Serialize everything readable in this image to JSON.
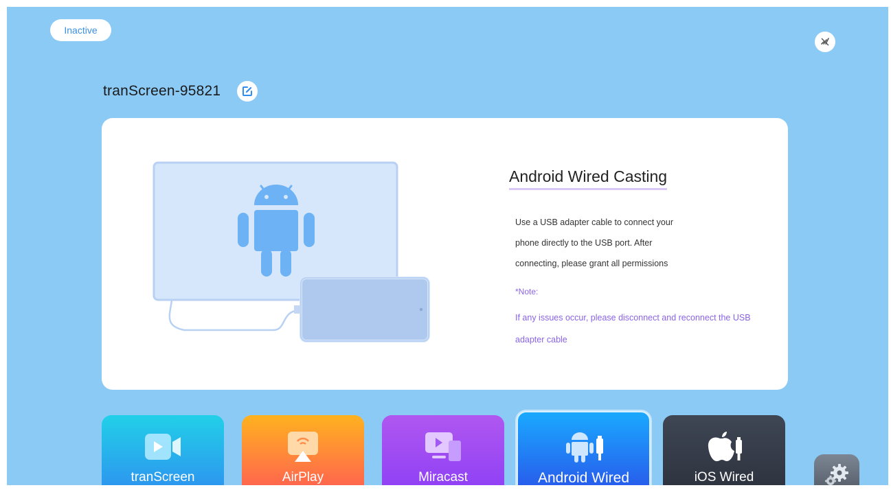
{
  "status": {
    "label": "Inactive"
  },
  "device": {
    "name": "tranScreen-95821"
  },
  "card": {
    "title": "Android Wired Casting",
    "description_lines": [
      "Use a USB adapter cable to connect your",
      "phone directly to the USB port. After",
      "connecting, please grant all permissions"
    ],
    "note_label": "*Note:",
    "note_lines": [
      "If any issues occur, please disconnect and reconnect the USB",
      "adapter cable"
    ]
  },
  "tabs": [
    {
      "id": "transcreen",
      "label": "tranScreen",
      "icon": "video-camera-icon",
      "selected": false
    },
    {
      "id": "airplay",
      "label": "AirPlay",
      "icon": "airplay-icon",
      "selected": false
    },
    {
      "id": "miracast",
      "label": "Miracast",
      "icon": "miracast-icon",
      "selected": false
    },
    {
      "id": "android",
      "label": "Android Wired",
      "icon": "android-usb-icon",
      "selected": true
    },
    {
      "id": "ios",
      "label": "iOS Wired",
      "icon": "apple-usb-icon",
      "selected": false
    }
  ],
  "colors": {
    "background": "#8ccaf6",
    "accent": "#3b8fe0",
    "note": "#8a63e6"
  }
}
